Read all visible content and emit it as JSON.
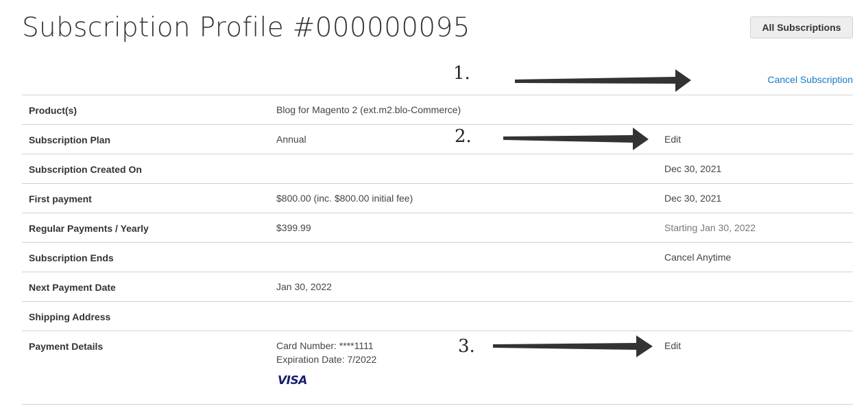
{
  "header": {
    "title": "Subscription Profile #000000095",
    "all_subscriptions_label": "All Subscriptions"
  },
  "annotations": {
    "marker1": "1.",
    "marker2": "2.",
    "marker3": "3."
  },
  "actions": {
    "cancel_subscription_label": "Cancel Subscription"
  },
  "rows": [
    {
      "label": "Product(s)",
      "value": "Blog for Magento 2 (ext.m2.blo-Commerce)",
      "extra": ""
    },
    {
      "label": "Subscription Plan",
      "value": "Annual",
      "extra": "Edit"
    },
    {
      "label": "Subscription Created On",
      "value": "",
      "extra": "Dec 30, 2021"
    },
    {
      "label": "First payment",
      "value": "$800.00 (inc. $800.00 initial fee)",
      "extra": "Dec 30, 2021"
    },
    {
      "label": "Regular Payments / Yearly",
      "value": "$399.99",
      "extra": "Starting Jan 30, 2022"
    },
    {
      "label": "Subscription Ends",
      "value": "",
      "extra": "Cancel Anytime"
    },
    {
      "label": "Next Payment Date",
      "value": "Jan 30, 2022",
      "extra": ""
    },
    {
      "label": "Shipping Address",
      "value": "",
      "extra": ""
    },
    {
      "label": "Payment Details",
      "value": "Card Number: ****1111",
      "value_line2": "Expiration Date: 7/2022",
      "card_brand": "VISA",
      "extra": "Edit"
    }
  ],
  "colors": {
    "link": "#1979c3",
    "text": "#333333",
    "muted": "#777777",
    "visa": "#1a1f71",
    "arrow": "#333333"
  },
  "icons": {
    "card_brand_icon": "visa-logo",
    "arrow_icon": "arrow-right-icon"
  }
}
